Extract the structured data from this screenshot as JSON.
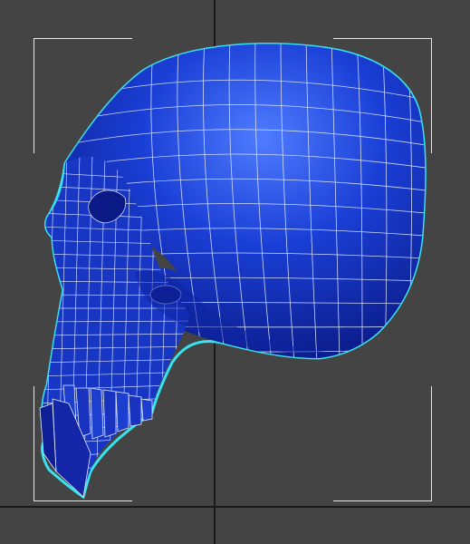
{
  "viewport": {
    "background_color": "#444444",
    "grid_line_color": "#1a1a1a",
    "selection_bracket_color": "#e8e8e8"
  },
  "model": {
    "subject": "skull-mesh",
    "surface_color": "#1a3fd6",
    "highlight_color": "#4f7cff",
    "shadow_color": "#0a1a86",
    "wireframe_color": "#e6ecff",
    "selection_outline_color": "#38e3f0",
    "selected": true,
    "display_mode": "shaded-with-wireframe"
  }
}
